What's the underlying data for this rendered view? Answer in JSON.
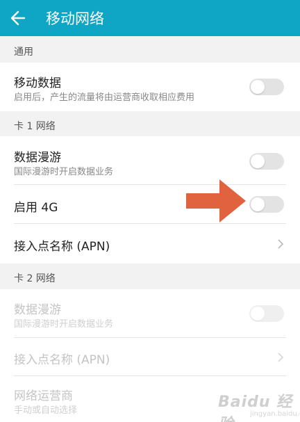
{
  "appbar": {
    "title": "移动网络",
    "background": "#0fa6c6"
  },
  "sections": {
    "general": {
      "header": "通用",
      "mobile_data": {
        "label": "移动数据",
        "sub": "启用后，产生的流量将由运营商收取相应费用",
        "on": false
      }
    },
    "card1": {
      "header": "卡 1 网络",
      "roaming": {
        "label": "数据漫游",
        "sub": "国际漫游时开启数据业务",
        "on": false
      },
      "enable_4g": {
        "label": "启用 4G",
        "on": false
      },
      "apn": {
        "label": "接入点名称 (APN)"
      }
    },
    "card2": {
      "header": "卡 2 网络",
      "roaming": {
        "label": "数据漫游",
        "sub": "国际漫游时开启数据业务",
        "on": false
      },
      "apn": {
        "label": "接入点名称 (APN)"
      },
      "operator": {
        "label": "网络运营商",
        "sub": "手动或自动选择"
      }
    }
  },
  "annotation": {
    "arrow_color": "#e0623f",
    "icon": "right-arrow-icon"
  },
  "watermark": {
    "text": "Baidu 经验",
    "sub": "jingyan.baidu.com"
  }
}
